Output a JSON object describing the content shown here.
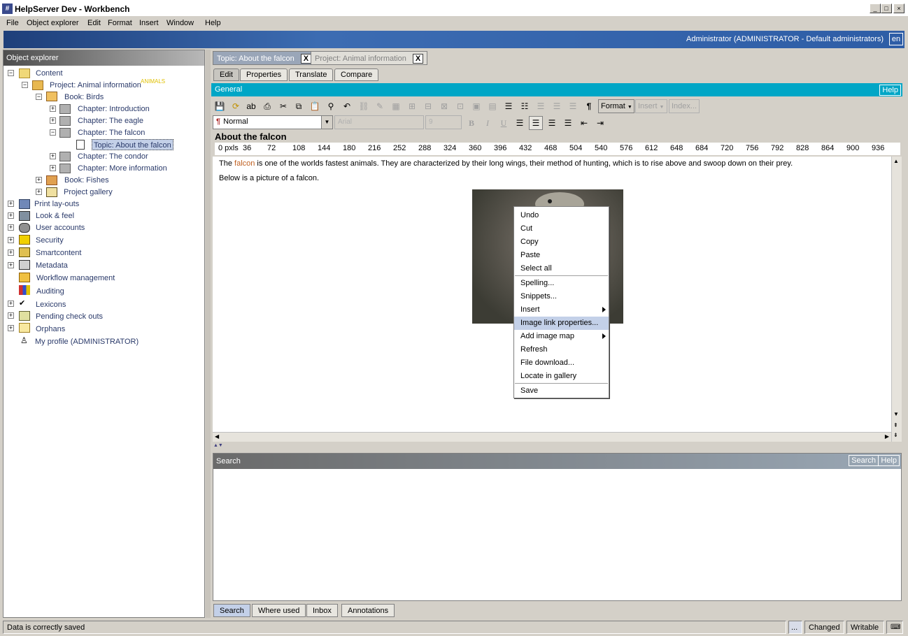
{
  "window": {
    "title": "HelpServer Dev - Workbench",
    "icon_glyph": "#",
    "min_glyph": "_",
    "max_glyph": "□",
    "close_glyph": "×"
  },
  "menu": [
    "File",
    "Object explorer",
    "Edit",
    "Format",
    "Insert",
    "Window",
    "Help"
  ],
  "banner": {
    "user": "Administrator (ADMINISTRATOR - Default administrators)",
    "lang": "en"
  },
  "object_explorer": {
    "title": "Object explorer",
    "tree": [
      {
        "label": "Content"
      },
      {
        "label": "Project: Animal information",
        "badge": "ANIMALS"
      },
      {
        "label": "Book: Birds"
      },
      {
        "label": "Chapter: Introduction"
      },
      {
        "label": "Chapter: The eagle"
      },
      {
        "label": "Chapter: The falcon"
      },
      {
        "label": "Topic: About the falcon"
      },
      {
        "label": "Chapter: The condor"
      },
      {
        "label": "Chapter: More information"
      },
      {
        "label": "Book: Fishes"
      },
      {
        "label": "Project gallery"
      },
      {
        "label": "Print lay-outs"
      },
      {
        "label": "Look & feel"
      },
      {
        "label": "User accounts"
      },
      {
        "label": "Security"
      },
      {
        "label": "Smartcontent"
      },
      {
        "label": "Metadata"
      },
      {
        "label": "Workflow management"
      },
      {
        "label": "Auditing"
      },
      {
        "label": "Lexicons"
      },
      {
        "label": "Pending check outs"
      },
      {
        "label": "Orphans"
      },
      {
        "label": "My profile (ADMINISTRATOR)"
      }
    ]
  },
  "doc_tabs": [
    {
      "label": "Topic: About the falcon",
      "close": "X"
    },
    {
      "label": "Project: Animal information",
      "close": "X"
    }
  ],
  "sub_tabs": [
    "Edit",
    "Properties",
    "Translate",
    "Compare"
  ],
  "general": {
    "label": "General",
    "help": "Help"
  },
  "toolbar": {
    "format": "Format",
    "insert": "Insert",
    "index": "Index...",
    "pilcrow": "¶"
  },
  "style": {
    "paragraph": "Normal",
    "font": "Arial",
    "size": "9",
    "bold": "B",
    "italic": "I",
    "underline": "U"
  },
  "document": {
    "title": "About the falcon",
    "para1_before": "The ",
    "para1_link": "falcon",
    "para1_after": " is one of the worlds fastest animals. They are characterized by their long wings, their method of hunting, which is to rise above and swoop down on their prey.",
    "para2": "Below is a picture of a falcon."
  },
  "ruler": {
    "unit": "0 pxls",
    "ticks": [
      "36",
      "72",
      "108",
      "144",
      "180",
      "216",
      "252",
      "288",
      "324",
      "360",
      "396",
      "432",
      "468",
      "504",
      "540",
      "576",
      "612",
      "648",
      "684",
      "720",
      "756",
      "792",
      "828",
      "864",
      "900",
      "936"
    ]
  },
  "context_menu": [
    {
      "label": "Undo"
    },
    {
      "label": "Cut"
    },
    {
      "label": "Copy"
    },
    {
      "label": "Paste"
    },
    {
      "label": "Select all"
    },
    {
      "label": "Spelling..."
    },
    {
      "label": "Snippets..."
    },
    {
      "label": "Insert"
    },
    {
      "label": "Image link properties..."
    },
    {
      "label": "Add image map"
    },
    {
      "label": "Refresh"
    },
    {
      "label": "File download..."
    },
    {
      "label": "Locate in gallery"
    },
    {
      "label": "Save"
    }
  ],
  "search": {
    "title": "Search",
    "search_btn": "Search",
    "help_btn": "Help"
  },
  "bottom_tabs": [
    "Search",
    "Where used",
    "Inbox",
    "Annotations"
  ],
  "status": {
    "message": "Data is correctly saved",
    "ellipsis": "...",
    "changed": "Changed",
    "writable": "Writable"
  }
}
